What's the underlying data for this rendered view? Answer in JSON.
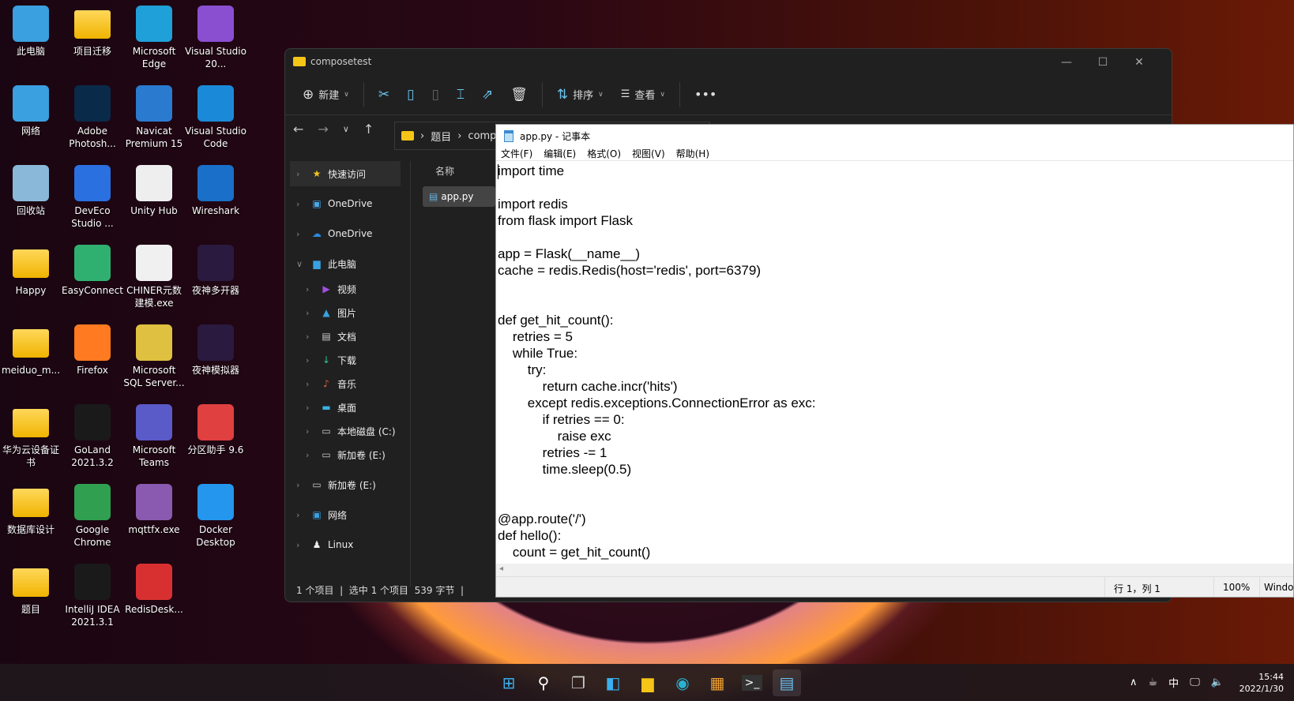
{
  "desktop": {
    "icons": [
      {
        "label": "此电脑",
        "icon": "computer-icon",
        "color": "#3aa0e0",
        "col": 0,
        "row": 0
      },
      {
        "label": "项目迁移",
        "icon": "folder-icon",
        "color": "#f5c518",
        "col": 1,
        "row": 0
      },
      {
        "label": "Microsoft Edge",
        "icon": "edge-icon",
        "color": "#1fa0d8",
        "col": 2,
        "row": 0
      },
      {
        "label": "Visual Studio 20...",
        "icon": "visual-studio-icon",
        "color": "#8a4fd0",
        "col": 3,
        "row": 0
      },
      {
        "label": "网络",
        "icon": "network-icon",
        "color": "#3aa0e0",
        "col": 0,
        "row": 1
      },
      {
        "label": "Adobe Photosh...",
        "icon": "photoshop-icon",
        "color": "#0a2a4a",
        "col": 1,
        "row": 1
      },
      {
        "label": "Navicat Premium 15",
        "icon": "navicat-icon",
        "color": "#2a7ad0",
        "col": 2,
        "row": 1
      },
      {
        "label": "Visual Studio Code",
        "icon": "vscode-icon",
        "color": "#1a8ad8",
        "col": 3,
        "row": 1
      },
      {
        "label": "回收站",
        "icon": "recycle-bin-icon",
        "color": "#8ab8d8",
        "col": 0,
        "row": 2
      },
      {
        "label": "DevEco Studio ...",
        "icon": "deveco-icon",
        "color": "#2a70e0",
        "col": 1,
        "row": 2
      },
      {
        "label": "Unity Hub",
        "icon": "unity-icon",
        "color": "#eeeeee",
        "col": 2,
        "row": 2
      },
      {
        "label": "Wireshark",
        "icon": "wireshark-icon",
        "color": "#1a70c8",
        "col": 3,
        "row": 2
      },
      {
        "label": "Happy",
        "icon": "folder-icon",
        "color": "#f5c518",
        "col": 0,
        "row": 3
      },
      {
        "label": "EasyConnect",
        "icon": "easyconnect-icon",
        "color": "#30b070",
        "col": 1,
        "row": 3
      },
      {
        "label": "CHINER元数建模.exe",
        "icon": "chiner-icon",
        "color": "#f0f0f0",
        "col": 2,
        "row": 3
      },
      {
        "label": "夜神多开器",
        "icon": "nox-icon",
        "color": "#2a1a40",
        "col": 3,
        "row": 3
      },
      {
        "label": "meiduo_m...",
        "icon": "folder-icon",
        "color": "#f5c518",
        "col": 0,
        "row": 4
      },
      {
        "label": "Firefox",
        "icon": "firefox-icon",
        "color": "#ff7a20",
        "col": 1,
        "row": 4
      },
      {
        "label": "Microsoft SQL Server...",
        "icon": "sql-server-icon",
        "color": "#e0c040",
        "col": 2,
        "row": 4
      },
      {
        "label": "夜神模拟器",
        "icon": "nox-icon",
        "color": "#2a1a40",
        "col": 3,
        "row": 4
      },
      {
        "label": "华为云设备证书",
        "icon": "folder-icon",
        "color": "#f5c518",
        "col": 0,
        "row": 5
      },
      {
        "label": "GoLand 2021.3.2",
        "icon": "goland-icon",
        "color": "#1a1a1a",
        "col": 1,
        "row": 5
      },
      {
        "label": "Microsoft Teams",
        "icon": "teams-icon",
        "color": "#5a5ac8",
        "col": 2,
        "row": 5
      },
      {
        "label": "分区助手 9.6",
        "icon": "partition-assistant-icon",
        "color": "#e04040",
        "col": 3,
        "row": 5
      },
      {
        "label": "数据库设计",
        "icon": "folder-icon",
        "color": "#f5c518",
        "col": 0,
        "row": 6
      },
      {
        "label": "Google Chrome",
        "icon": "chrome-icon",
        "color": "#30a050",
        "col": 1,
        "row": 6
      },
      {
        "label": "mqttfx.exe",
        "icon": "mqttfx-icon",
        "color": "#8a5ab0",
        "col": 2,
        "row": 6
      },
      {
        "label": "Docker Desktop",
        "icon": "docker-icon",
        "color": "#2496ed",
        "col": 3,
        "row": 6
      },
      {
        "label": "题目",
        "icon": "folder-icon",
        "color": "#f5c518",
        "col": 0,
        "row": 7
      },
      {
        "label": "IntelliJ IDEA 2021.3.1",
        "icon": "intellij-icon",
        "color": "#1a1a1a",
        "col": 1,
        "row": 7
      },
      {
        "label": "RedisDesk...",
        "icon": "redis-icon",
        "color": "#d83030",
        "col": 2,
        "row": 7
      }
    ]
  },
  "explorer": {
    "title": "composetest",
    "toolbar": {
      "new": "新建",
      "sort": "排序",
      "view": "查看"
    },
    "breadcrumb": [
      "题目",
      "comp"
    ],
    "column_name": "名称",
    "file": "app.py",
    "nav": [
      {
        "label": "快速访问",
        "icon": "star-icon",
        "glyph": "★",
        "color": "#f5c518",
        "sub": false,
        "sel": true
      },
      {
        "label": "OneDrive",
        "icon": "onedrive-icon",
        "glyph": "▣",
        "color": "#4aa8e8",
        "sub": false
      },
      {
        "label": "OneDrive",
        "icon": "cloud-icon",
        "glyph": "☁",
        "color": "#2a8ae0",
        "sub": false
      },
      {
        "label": "此电脑",
        "icon": "computer-icon",
        "glyph": "▆",
        "color": "#3aa0e0",
        "sub": false,
        "open": true
      },
      {
        "label": "视频",
        "icon": "video-icon",
        "glyph": "▶",
        "color": "#a050e0",
        "sub": true
      },
      {
        "label": "图片",
        "icon": "pictures-icon",
        "glyph": "▲",
        "color": "#3aa0e0",
        "sub": true
      },
      {
        "label": "文档",
        "icon": "documents-icon",
        "glyph": "▤",
        "color": "#ccc",
        "sub": true
      },
      {
        "label": "下载",
        "icon": "download-icon",
        "glyph": "↓",
        "color": "#30c0a0",
        "sub": true
      },
      {
        "label": "音乐",
        "icon": "music-icon",
        "glyph": "♪",
        "color": "#e06040",
        "sub": true
      },
      {
        "label": "桌面",
        "icon": "desktop-icon",
        "glyph": "▬",
        "color": "#3ab0e0",
        "sub": true
      },
      {
        "label": "本地磁盘 (C:)",
        "icon": "drive-icon",
        "glyph": "▭",
        "color": "#ccc",
        "sub": true
      },
      {
        "label": "新加卷 (E:)",
        "icon": "drive-icon",
        "glyph": "▭",
        "color": "#ccc",
        "sub": true
      },
      {
        "label": "新加卷 (E:)",
        "icon": "drive-icon",
        "glyph": "▭",
        "color": "#ccc",
        "sub": false
      },
      {
        "label": "网络",
        "icon": "network-icon",
        "glyph": "▣",
        "color": "#3aa0e0",
        "sub": false
      },
      {
        "label": "Linux",
        "icon": "linux-icon",
        "glyph": "♟",
        "color": "#eee",
        "sub": false
      }
    ],
    "status": "1 个项目  |  选中 1 个项目  539 字节  |"
  },
  "notepad": {
    "title": "app.py - 记事本",
    "menu": [
      "文件(F)",
      "编辑(E)",
      "格式(O)",
      "视图(V)",
      "帮助(H)"
    ],
    "text": "import time\n\nimport redis\nfrom flask import Flask\n\napp = Flask(__name__)\ncache = redis.Redis(host='redis', port=6379)\n\n\ndef get_hit_count():\n    retries = 5\n    while True:\n        try:\n            return cache.incr('hits')\n        except redis.exceptions.ConnectionError as exc:\n            if retries == 0:\n                raise exc\n            retries -= 1\n            time.sleep(0.5)\n\n\n@app.route('/')\ndef hello():\n    count = get_hit_count()\n    return 'Hello World! I have been seen {} times.\\n'.format(count)",
    "status": {
      "position": "行 1，列 1",
      "zoom": "100%",
      "encoding": "Windows"
    }
  },
  "taskbar": {
    "clock_time": "15:44",
    "clock_date": "2022/1/30",
    "ime": "中"
  }
}
